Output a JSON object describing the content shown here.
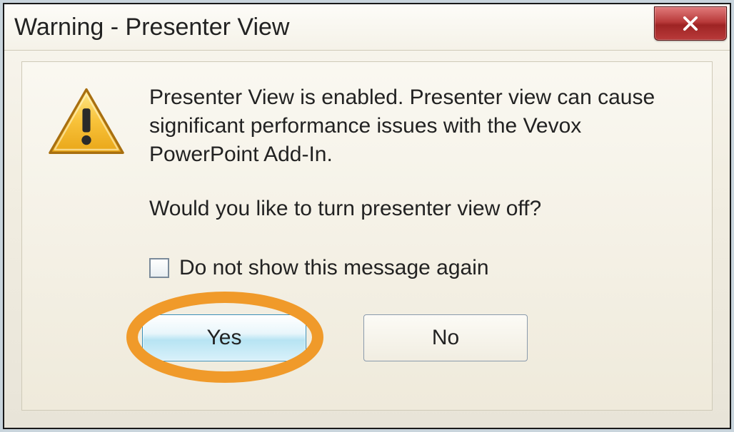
{
  "dialog": {
    "title": "Warning - Presenter View",
    "close_glyph": "x",
    "message_line1": "Presenter View is enabled. Presenter view can cause significant performance issues with the Vevox  PowerPoint Add-In.",
    "message_line2": "Would you like to turn presenter view off?",
    "checkbox_label": "Do not show this message again",
    "buttons": {
      "yes": "Yes",
      "no": "No"
    }
  },
  "annotation": {
    "highlight_color": "#f09a2a"
  }
}
